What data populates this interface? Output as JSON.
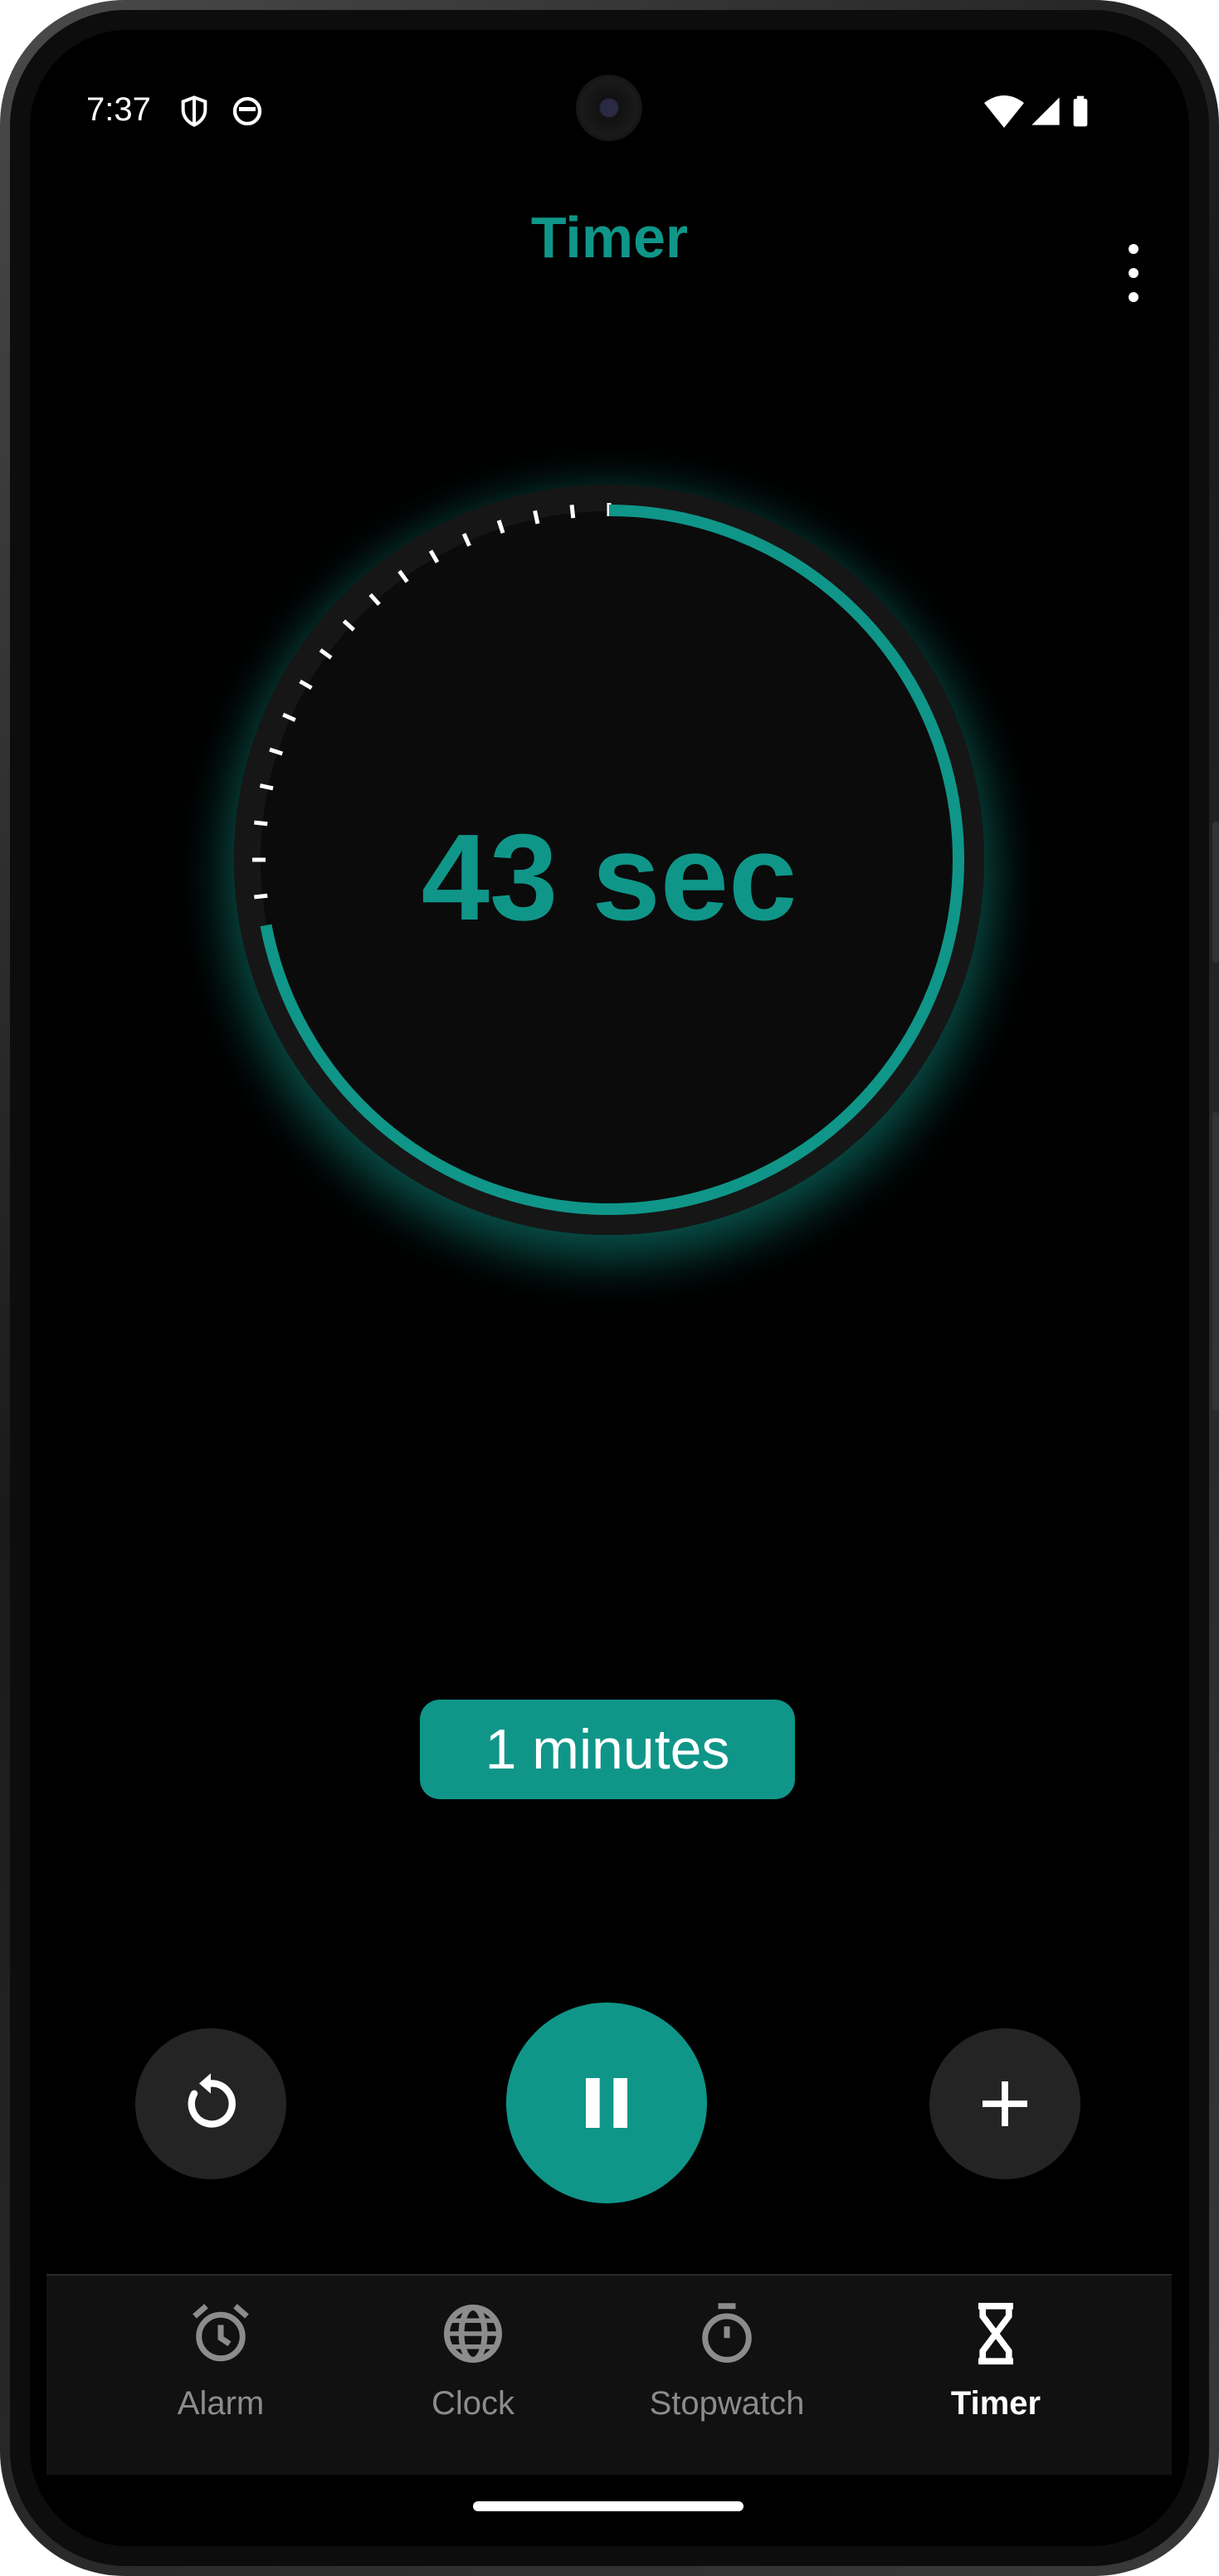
{
  "status_bar": {
    "time": "7:37",
    "icons": [
      "shield-icon",
      "cat-face-icon",
      "wifi-icon",
      "cellular-signal-icon",
      "battery-icon"
    ]
  },
  "app": {
    "title": "Timer",
    "accent_color": "#0f9689",
    "more_icon": "more-vert-icon"
  },
  "timer": {
    "remaining_label": "43 sec",
    "elapsed_fraction": 0.28,
    "duration_chip": "1 minutes"
  },
  "controls": {
    "reset_icon": "restart-icon",
    "pause_icon": "pause-icon",
    "add_icon": "add-icon"
  },
  "bottom_nav": {
    "items": [
      {
        "label": "Alarm",
        "icon": "alarm-clock-icon",
        "active": false
      },
      {
        "label": "Clock",
        "icon": "globe-icon",
        "active": false
      },
      {
        "label": "Stopwatch",
        "icon": "stopwatch-icon",
        "active": false
      },
      {
        "label": "Timer",
        "icon": "hourglass-icon",
        "active": true
      }
    ]
  }
}
